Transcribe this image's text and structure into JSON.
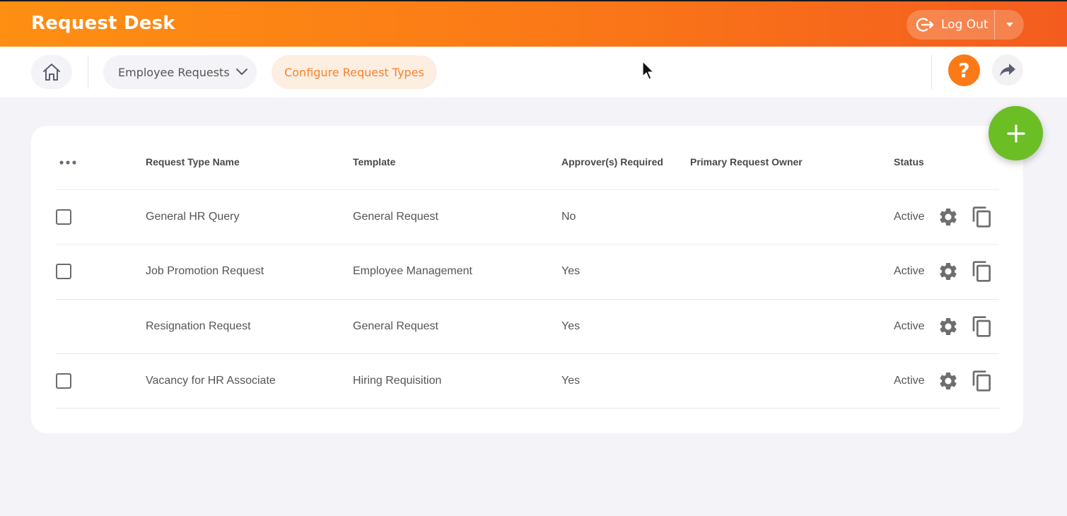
{
  "header": {
    "app_title": "Request Desk",
    "logout_label": "Log Out",
    "colors": {
      "start": "#fe8f13",
      "end": "#f35c1e"
    }
  },
  "nav": {
    "home_icon": "home-icon",
    "dropdown_label": "Employee Requests",
    "config_label": "Configure Request Types",
    "help_icon": "question-mark-icon",
    "share_icon": "share-arrow-icon"
  },
  "table": {
    "columns": [
      "Request Type Name",
      "Template",
      "Approver(s) Required",
      "Primary Request Owner",
      "Status"
    ],
    "rows": [
      {
        "name": "General HR Query",
        "template": "General Request",
        "approver": "No",
        "owner": "",
        "status": "Active",
        "has_checkbox": true
      },
      {
        "name": "Job Promotion Request",
        "template": "Employee Management",
        "approver": "Yes",
        "owner": "",
        "status": "Active",
        "has_checkbox": true
      },
      {
        "name": "Resignation Request",
        "template": "General Request",
        "approver": "Yes",
        "owner": "",
        "status": "Active",
        "has_checkbox": false
      },
      {
        "name": "Vacancy for HR Associate",
        "template": "Hiring Requisition",
        "approver": "Yes",
        "owner": "",
        "status": "Active",
        "has_checkbox": true
      }
    ]
  },
  "accent": {
    "orange": "#fb7a17",
    "green": "#6cbe25"
  }
}
